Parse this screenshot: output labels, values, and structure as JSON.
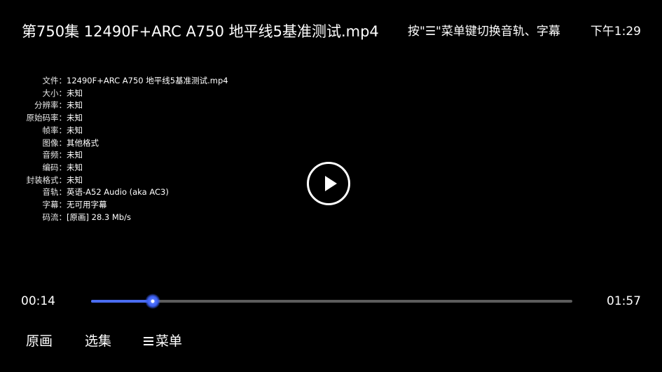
{
  "header": {
    "title": "第750集 12490F+ARC A750 地平线5基准测试.mp4",
    "hint": "按\"☰\"菜单键切换音轨、字幕",
    "clock": "下午1:29"
  },
  "info": [
    {
      "label": "文件",
      "value": "12490F+ARC A750 地平线5基准测试.mp4"
    },
    {
      "label": "大小",
      "value": "未知"
    },
    {
      "label": "分辨率",
      "value": "未知"
    },
    {
      "label": "原始码率",
      "value": "未知"
    },
    {
      "label": "帧率",
      "value": "未知"
    },
    {
      "label": "图像",
      "value": "其他格式"
    },
    {
      "label": "音频",
      "value": "未知"
    },
    {
      "label": "编码",
      "value": "未知"
    },
    {
      "label": "封装格式",
      "value": "未知"
    },
    {
      "label": "音轨",
      "value": "英语-A52 Audio (aka AC3)"
    },
    {
      "label": "字幕",
      "value": "无可用字幕"
    },
    {
      "label": "码流",
      "value": "[原画] 28.3 Mb/s"
    }
  ],
  "label_separator": "：",
  "player": {
    "play_icon": "play-icon",
    "current_time": "00:14",
    "total_time": "01:57",
    "progress": 0.128,
    "accent_color": "#4a6cf0"
  },
  "bottom_menu": {
    "original": "原画",
    "episodes": "选集",
    "menu": "菜单",
    "menu_icon": "hamburger-icon"
  }
}
